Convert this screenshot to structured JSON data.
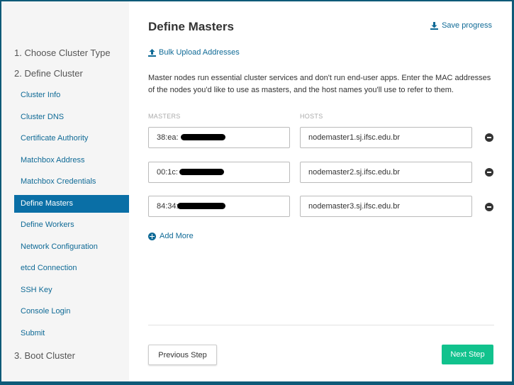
{
  "sidebar": {
    "steps": [
      {
        "label": "1. Choose Cluster Type"
      },
      {
        "label": "2. Define Cluster"
      },
      {
        "label": "3. Boot Cluster"
      }
    ],
    "items": [
      {
        "label": "Cluster Info"
      },
      {
        "label": "Cluster DNS"
      },
      {
        "label": "Certificate Authority"
      },
      {
        "label": "Matchbox Address"
      },
      {
        "label": "Matchbox Credentials"
      },
      {
        "label": "Define Masters"
      },
      {
        "label": "Define Workers"
      },
      {
        "label": "Network Configuration"
      },
      {
        "label": "etcd Connection"
      },
      {
        "label": "SSH Key"
      },
      {
        "label": "Console Login"
      },
      {
        "label": "Submit"
      }
    ],
    "active_item": "Define Masters"
  },
  "main": {
    "title": "Define Masters",
    "save_progress": "Save progress",
    "bulk_upload": "Bulk Upload Addresses",
    "description": "Master nodes run essential cluster services and don't run end-user apps. Enter the MAC addresses of the nodes you'd like to use as masters, and the host names you'll use to refer to them.",
    "masters_label": "MASTERS",
    "hosts_label": "HOSTS",
    "rows": [
      {
        "mac": "38:ea:",
        "host": "nodemaster1.sj.ifsc.edu.br"
      },
      {
        "mac": "00:1c:",
        "host": "nodemaster2.sj.ifsc.edu.br"
      },
      {
        "mac": "84:34:",
        "host": "nodemaster3.sj.ifsc.edu.br"
      }
    ],
    "add_more": "Add More",
    "previous_step": "Previous Step",
    "next_step": "Next Step"
  },
  "colors": {
    "accent": "#0f6a96",
    "active_bg": "#0a6fa6",
    "next_button": "#11c28d",
    "frame": "#0e5a78"
  }
}
